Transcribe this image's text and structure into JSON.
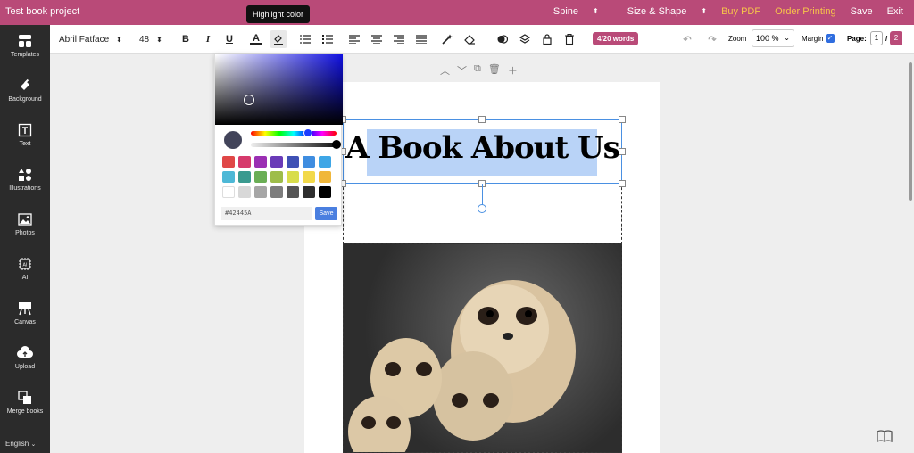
{
  "topbar": {
    "project_title": "Test book project",
    "spine": "Spine",
    "size_shape": "Size & Shape",
    "buy_pdf": "Buy PDF",
    "order_printing": "Order Printing",
    "save": "Save",
    "exit": "Exit",
    "accent_color": "#b94a78"
  },
  "sidebar": {
    "items": [
      {
        "label": "Templates",
        "icon": "templates-icon"
      },
      {
        "label": "Background",
        "icon": "paint-bucket-icon"
      },
      {
        "label": "Text",
        "icon": "text-icon"
      },
      {
        "label": "Illustrations",
        "icon": "shapes-icon"
      },
      {
        "label": "Photos",
        "icon": "image-icon"
      },
      {
        "label": "AI",
        "icon": "ai-chip-icon"
      },
      {
        "label": "Canvas",
        "icon": "easel-icon"
      },
      {
        "label": "Upload",
        "icon": "upload-icon"
      },
      {
        "label": "Merge books",
        "icon": "merge-icon"
      }
    ],
    "language": "English"
  },
  "toolbar": {
    "font_family": "Abril Fatface",
    "font_size": "48",
    "word_count": "4/20 words",
    "zoom_label": "Zoom",
    "zoom_value": "100 %",
    "margin_label": "Margin",
    "page_label": "Page:",
    "current_page": "1",
    "page_sep": "/",
    "total_pages": "2"
  },
  "tooltip": {
    "text": "Highlight color"
  },
  "canvas": {
    "headline": "A Book About Us"
  },
  "color_picker": {
    "hex_value": "#42445A",
    "save_label": "Save",
    "swatches": [
      "#e04747",
      "#d63a6c",
      "#9b2fb3",
      "#6a3bb8",
      "#3f51b5",
      "#3f8de0",
      "#3ea6e6",
      "#4db8d6",
      "#3a9a8f",
      "#6aae55",
      "#9ebd4a",
      "#d8dd4c",
      "#f2d94a",
      "#f0b73b",
      "#ffffff",
      "#d8d8d8",
      "#a6a6a6",
      "#7d7d7d",
      "#555555",
      "#2e2e2e",
      "#000000"
    ]
  }
}
